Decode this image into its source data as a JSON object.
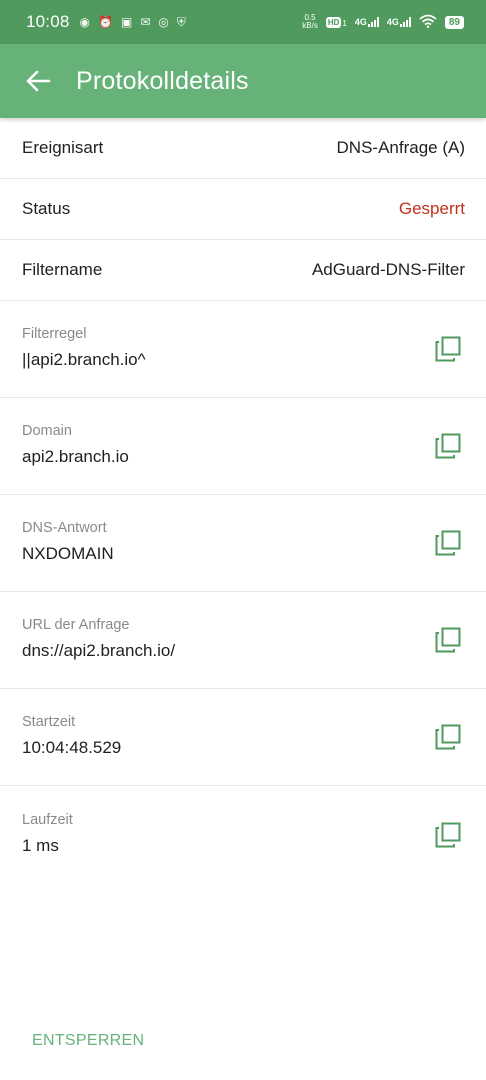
{
  "status_bar": {
    "time": "10:08",
    "speed_value": "0.5",
    "speed_unit": "kB/s",
    "hd": "HD",
    "hd_sub": "1",
    "net1": "4G",
    "net2": "4G",
    "battery": "89"
  },
  "app_bar": {
    "title": "Protokolldetails"
  },
  "rows_simple": [
    {
      "label": "Ereignisart",
      "value": "DNS-Anfrage (A)"
    },
    {
      "label": "Status",
      "value": "Gesperrt"
    },
    {
      "label": "Filtername",
      "value": "AdGuard-DNS-Filter"
    }
  ],
  "rows_detail": [
    {
      "label": "Filterregel",
      "value": "||api2.branch.io^"
    },
    {
      "label": "Domain",
      "value": "api2.branch.io"
    },
    {
      "label": "DNS-Antwort",
      "value": "NXDOMAIN"
    },
    {
      "label": "URL der Anfrage",
      "value": "dns://api2.branch.io/"
    },
    {
      "label": "Startzeit",
      "value": "10:04:48.529"
    },
    {
      "label": "Laufzeit",
      "value": "1 ms"
    }
  ],
  "actions": {
    "unblock": "ENTSPERREN"
  },
  "colors": {
    "status_bar": "#4f9a5c",
    "app_bar": "#67b279",
    "blocked": "#c4301c",
    "accent": "#67b279"
  }
}
